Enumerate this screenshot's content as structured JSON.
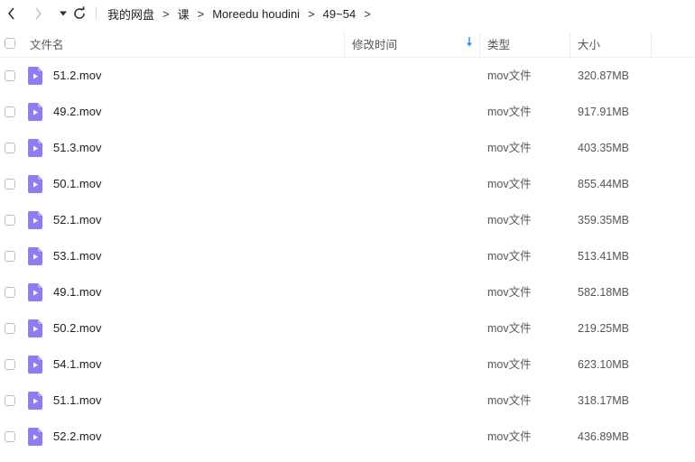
{
  "toolbar": {
    "back_icon": "chevron-left-icon",
    "forward_icon": "chevron-right-icon",
    "dropdown_icon": "caret-down-icon",
    "refresh_icon": "refresh-icon"
  },
  "breadcrumb": [
    "我的网盘",
    "课",
    "Moreedu houdini",
    "49~54"
  ],
  "breadcrumb_separator": ">",
  "columns": {
    "name": "文件名",
    "modified": "修改时间",
    "type": "类型",
    "size": "大小"
  },
  "colors": {
    "accent": "#2a8cf0",
    "file_icon": "#8f7cf0"
  },
  "files": [
    {
      "name": "51.2.mov",
      "type": "mov文件",
      "size": "320.87MB"
    },
    {
      "name": "49.2.mov",
      "type": "mov文件",
      "size": "917.91MB"
    },
    {
      "name": "51.3.mov",
      "type": "mov文件",
      "size": "403.35MB"
    },
    {
      "name": "50.1.mov",
      "type": "mov文件",
      "size": "855.44MB"
    },
    {
      "name": "52.1.mov",
      "type": "mov文件",
      "size": "359.35MB"
    },
    {
      "name": "53.1.mov",
      "type": "mov文件",
      "size": "513.41MB"
    },
    {
      "name": "49.1.mov",
      "type": "mov文件",
      "size": "582.18MB"
    },
    {
      "name": "50.2.mov",
      "type": "mov文件",
      "size": "219.25MB"
    },
    {
      "name": "54.1.mov",
      "type": "mov文件",
      "size": "623.10MB"
    },
    {
      "name": "51.1.mov",
      "type": "mov文件",
      "size": "318.17MB"
    },
    {
      "name": "52.2.mov",
      "type": "mov文件",
      "size": "436.89MB"
    }
  ]
}
